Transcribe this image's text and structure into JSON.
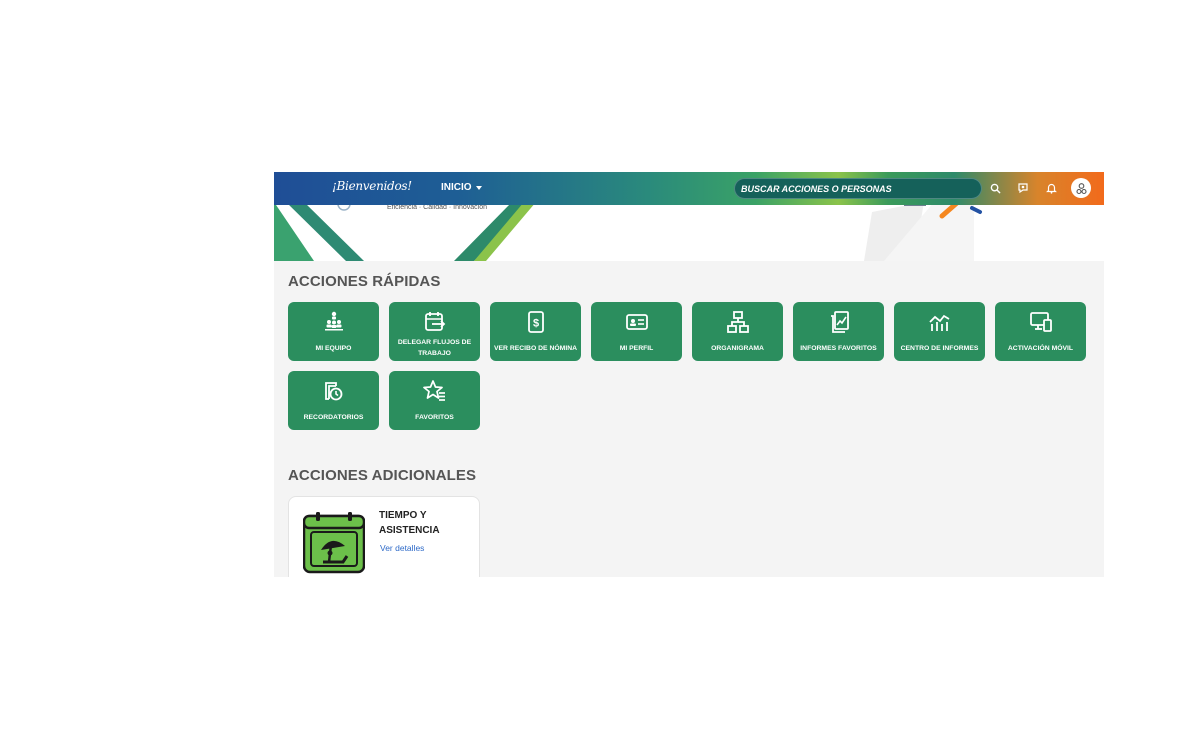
{
  "header": {
    "logo_text": "¡Bienvenidos!",
    "nav_label": "INICIO",
    "search_placeholder": "BUSCAR ACCIONES O PERSONAS",
    "icons": [
      "search-icon",
      "chat-icon",
      "bell-icon",
      "user-avatar-icon"
    ]
  },
  "banner": {
    "tagline": "Eficiencia · Calidad · Innovación"
  },
  "quick_actions": {
    "title": "ACCIONES RÁPIDAS",
    "items": [
      {
        "label": "MI EQUIPO",
        "icon": "team-icon"
      },
      {
        "label": "DELEGAR FLUJOS DE TRABAJO",
        "icon": "calendar-delegate-icon"
      },
      {
        "label": "VER RECIBO DE NÓMINA",
        "icon": "payslip-icon"
      },
      {
        "label": "MI PERFIL",
        "icon": "id-card-icon"
      },
      {
        "label": "ORGANIGRAMA",
        "icon": "org-chart-icon"
      },
      {
        "label": "INFORMES FAVORITOS",
        "icon": "favorite-reports-icon"
      },
      {
        "label": "CENTRO DE INFORMES",
        "icon": "report-chart-icon"
      },
      {
        "label": "ACTIVACIÓN MÓVIL",
        "icon": "mobile-devices-icon"
      },
      {
        "label": "RECORDATORIOS",
        "icon": "reminders-icon"
      },
      {
        "label": "FAVORITOS",
        "icon": "star-list-icon"
      }
    ]
  },
  "additional_actions": {
    "title": "ACCIONES ADICIONALES",
    "cards": [
      {
        "title": "TIEMPO Y ASISTENCIA",
        "link": "Ver detalles",
        "icon": "calendar-vacation-icon"
      }
    ]
  },
  "colors": {
    "tile_green": "#2b8e5e",
    "card_icon_green": "#6cc04a",
    "link_blue": "#2e6ac8",
    "header_start": "#1f4e96",
    "header_end": "#f26a1b"
  }
}
